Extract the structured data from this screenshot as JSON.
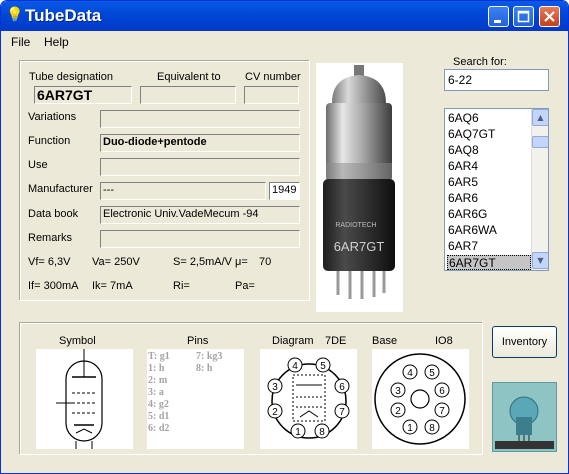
{
  "window": {
    "title": "TubeData"
  },
  "menu": {
    "file": "File",
    "help": "Help"
  },
  "labels": {
    "tube_designation": "Tube designation",
    "equivalent_to": "Equivalent to",
    "cv_number": "CV number",
    "variations": "Variations",
    "function": "Function",
    "use": "Use",
    "manufacturer": "Manufacturer",
    "data_book": "Data book",
    "remarks": "Remarks",
    "search_for": "Search for:",
    "symbol": "Symbol",
    "pins": "Pins",
    "diagram": "Diagram",
    "diagram_code": "7DE",
    "base": "Base",
    "base_code": "IO8"
  },
  "values": {
    "tube_designation": "6AR7GT",
    "equivalent_to": "",
    "cv_number": "",
    "variations": "",
    "function": "Duo-diode+pentode",
    "use": "",
    "manufacturer": "---",
    "year": "1949",
    "data_book": "Electronic Univ.VadeMecum -94",
    "remarks": ""
  },
  "params": {
    "vf": "Vf= 6,3V",
    "va": "Va= 250V",
    "s": "S= 2,5mA/V",
    "mu_label": "μ=",
    "mu": "70",
    "if": "If= 300mA",
    "ik": "Ik= 7mA",
    "ri": "Ri=",
    "pa": "Pa="
  },
  "search": {
    "value": "6-22"
  },
  "tube_list": [
    "6AQ6",
    "6AQ7GT",
    "6AQ8",
    "6AR4",
    "6AR5",
    "6AR6",
    "6AR6G",
    "6AR6WA",
    "6AR7",
    "6AR7GT"
  ],
  "selected_tube": "6AR7GT",
  "pins_col1": [
    "T: g1",
    "1: h",
    "2: m",
    "3: a",
    "4: g2",
    "5: d1",
    "6: d2"
  ],
  "pins_col2": [
    "7: kg3",
    "8: h"
  ],
  "photo_text": {
    "brand": "RADIOTECH",
    "model": "6AR7GT"
  },
  "buttons": {
    "inventory": "Inventory"
  },
  "colors": {
    "titlebar": "#0054e3",
    "selection": "#c5c5c5",
    "pin_text": "#a3a3a3"
  }
}
